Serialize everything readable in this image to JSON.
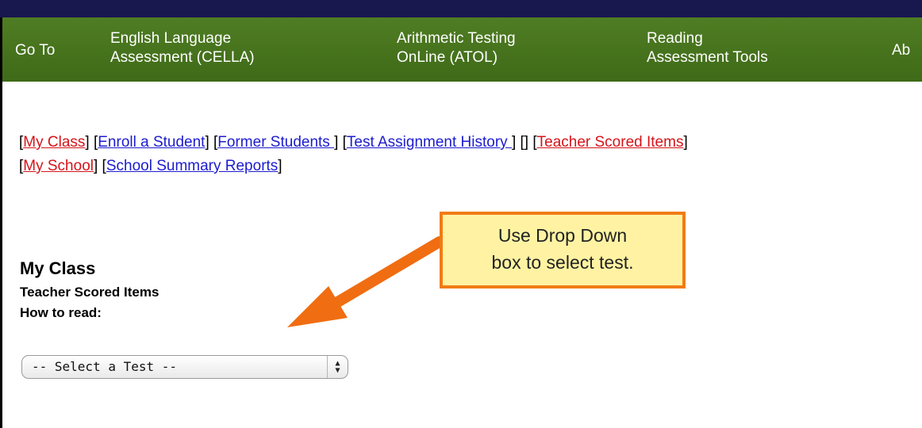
{
  "nav": {
    "items": [
      {
        "label": "Go To"
      },
      {
        "label_line1": "English Language",
        "label_line2": "Assessment (CELLA)"
      },
      {
        "label_line1": "Arithmetic Testing",
        "label_line2": "OnLine (ATOL)"
      },
      {
        "label_line1": "Reading",
        "label_line2": "Assessment Tools"
      },
      {
        "label": "Ab"
      }
    ]
  },
  "links": [
    {
      "text": "My Class",
      "color": "#d4141a"
    },
    {
      "text": "Enroll a Student",
      "color": "#1c1ccf"
    },
    {
      "text": "Former Students ",
      "color": "#1c1ccf"
    },
    {
      "text": "Test Assignment History ",
      "color": "#1c1ccf"
    },
    {
      "text": "Teacher Scored Items",
      "color": "#d4141a"
    },
    {
      "text": "My School",
      "color": "#d4141a"
    },
    {
      "text": "School Summary Reports",
      "color": "#1c1ccf"
    }
  ],
  "section": {
    "title": "My Class",
    "subtitle": "Teacher Scored Items",
    "how_to": "How to read:"
  },
  "select": {
    "value": "-- Select a Test --",
    "arrows_icon": "up-down-chevron-icon"
  },
  "callout": {
    "line1": "Use Drop Down",
    "line2": "box to select test."
  },
  "colors": {
    "nav_green": "#46721c",
    "callout_fill": "#fff3a3",
    "callout_border": "#f07c16",
    "arrow": "#f06d12"
  }
}
